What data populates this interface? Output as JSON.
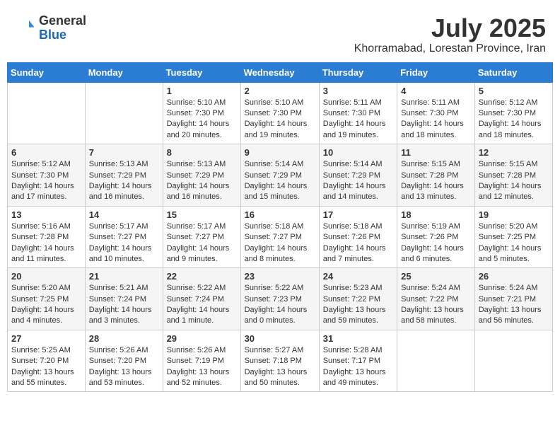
{
  "header": {
    "logo_general": "General",
    "logo_blue": "Blue",
    "month_title": "July 2025",
    "location": "Khorramabad, Lorestan Province, Iran"
  },
  "days_of_week": [
    "Sunday",
    "Monday",
    "Tuesday",
    "Wednesday",
    "Thursday",
    "Friday",
    "Saturday"
  ],
  "weeks": [
    [
      {
        "day": "",
        "info": ""
      },
      {
        "day": "",
        "info": ""
      },
      {
        "day": "1",
        "info": "Sunrise: 5:10 AM\nSunset: 7:30 PM\nDaylight: 14 hours and 20 minutes."
      },
      {
        "day": "2",
        "info": "Sunrise: 5:10 AM\nSunset: 7:30 PM\nDaylight: 14 hours and 19 minutes."
      },
      {
        "day": "3",
        "info": "Sunrise: 5:11 AM\nSunset: 7:30 PM\nDaylight: 14 hours and 19 minutes."
      },
      {
        "day": "4",
        "info": "Sunrise: 5:11 AM\nSunset: 7:30 PM\nDaylight: 14 hours and 18 minutes."
      },
      {
        "day": "5",
        "info": "Sunrise: 5:12 AM\nSunset: 7:30 PM\nDaylight: 14 hours and 18 minutes."
      }
    ],
    [
      {
        "day": "6",
        "info": "Sunrise: 5:12 AM\nSunset: 7:30 PM\nDaylight: 14 hours and 17 minutes."
      },
      {
        "day": "7",
        "info": "Sunrise: 5:13 AM\nSunset: 7:29 PM\nDaylight: 14 hours and 16 minutes."
      },
      {
        "day": "8",
        "info": "Sunrise: 5:13 AM\nSunset: 7:29 PM\nDaylight: 14 hours and 16 minutes."
      },
      {
        "day": "9",
        "info": "Sunrise: 5:14 AM\nSunset: 7:29 PM\nDaylight: 14 hours and 15 minutes."
      },
      {
        "day": "10",
        "info": "Sunrise: 5:14 AM\nSunset: 7:29 PM\nDaylight: 14 hours and 14 minutes."
      },
      {
        "day": "11",
        "info": "Sunrise: 5:15 AM\nSunset: 7:28 PM\nDaylight: 14 hours and 13 minutes."
      },
      {
        "day": "12",
        "info": "Sunrise: 5:15 AM\nSunset: 7:28 PM\nDaylight: 14 hours and 12 minutes."
      }
    ],
    [
      {
        "day": "13",
        "info": "Sunrise: 5:16 AM\nSunset: 7:28 PM\nDaylight: 14 hours and 11 minutes."
      },
      {
        "day": "14",
        "info": "Sunrise: 5:17 AM\nSunset: 7:27 PM\nDaylight: 14 hours and 10 minutes."
      },
      {
        "day": "15",
        "info": "Sunrise: 5:17 AM\nSunset: 7:27 PM\nDaylight: 14 hours and 9 minutes."
      },
      {
        "day": "16",
        "info": "Sunrise: 5:18 AM\nSunset: 7:27 PM\nDaylight: 14 hours and 8 minutes."
      },
      {
        "day": "17",
        "info": "Sunrise: 5:18 AM\nSunset: 7:26 PM\nDaylight: 14 hours and 7 minutes."
      },
      {
        "day": "18",
        "info": "Sunrise: 5:19 AM\nSunset: 7:26 PM\nDaylight: 14 hours and 6 minutes."
      },
      {
        "day": "19",
        "info": "Sunrise: 5:20 AM\nSunset: 7:25 PM\nDaylight: 14 hours and 5 minutes."
      }
    ],
    [
      {
        "day": "20",
        "info": "Sunrise: 5:20 AM\nSunset: 7:25 PM\nDaylight: 14 hours and 4 minutes."
      },
      {
        "day": "21",
        "info": "Sunrise: 5:21 AM\nSunset: 7:24 PM\nDaylight: 14 hours and 3 minutes."
      },
      {
        "day": "22",
        "info": "Sunrise: 5:22 AM\nSunset: 7:24 PM\nDaylight: 14 hours and 1 minute."
      },
      {
        "day": "23",
        "info": "Sunrise: 5:22 AM\nSunset: 7:23 PM\nDaylight: 14 hours and 0 minutes."
      },
      {
        "day": "24",
        "info": "Sunrise: 5:23 AM\nSunset: 7:22 PM\nDaylight: 13 hours and 59 minutes."
      },
      {
        "day": "25",
        "info": "Sunrise: 5:24 AM\nSunset: 7:22 PM\nDaylight: 13 hours and 58 minutes."
      },
      {
        "day": "26",
        "info": "Sunrise: 5:24 AM\nSunset: 7:21 PM\nDaylight: 13 hours and 56 minutes."
      }
    ],
    [
      {
        "day": "27",
        "info": "Sunrise: 5:25 AM\nSunset: 7:20 PM\nDaylight: 13 hours and 55 minutes."
      },
      {
        "day": "28",
        "info": "Sunrise: 5:26 AM\nSunset: 7:20 PM\nDaylight: 13 hours and 53 minutes."
      },
      {
        "day": "29",
        "info": "Sunrise: 5:26 AM\nSunset: 7:19 PM\nDaylight: 13 hours and 52 minutes."
      },
      {
        "day": "30",
        "info": "Sunrise: 5:27 AM\nSunset: 7:18 PM\nDaylight: 13 hours and 50 minutes."
      },
      {
        "day": "31",
        "info": "Sunrise: 5:28 AM\nSunset: 7:17 PM\nDaylight: 13 hours and 49 minutes."
      },
      {
        "day": "",
        "info": ""
      },
      {
        "day": "",
        "info": ""
      }
    ]
  ]
}
